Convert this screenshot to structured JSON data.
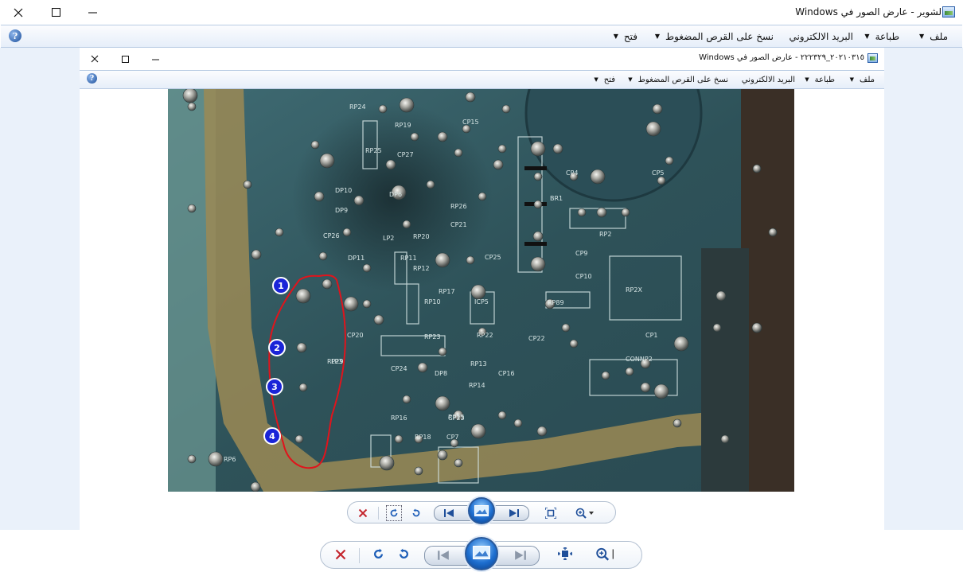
{
  "outer_window": {
    "title": "لشوير - عارض الصور في Windows",
    "menu": {
      "file": "ملف",
      "print": "طباعة",
      "email": "البريد الالكتروني",
      "burn": "نسخ على القرص المضغوط",
      "open": "فتح"
    }
  },
  "inner_window": {
    "title": "٢٠٢١٠٣١٥_٢٢٢٣٢٩ - عارض الصور في Windows",
    "menu": {
      "file": "ملف",
      "print": "طباعة",
      "email": "البريد الالكتروني",
      "burn": "نسخ على القرص المضغوط",
      "open": "فتح"
    }
  },
  "photo": {
    "markers": [
      "1",
      "2",
      "3",
      "4"
    ],
    "pcb_labels": [
      "CP15",
      "CP27",
      "RP25",
      "RP24",
      "RP19",
      "DP10",
      "DP9",
      "DP6",
      "RP26",
      "CP21",
      "RP20",
      "CP26",
      "LP2",
      "RP11",
      "RP12",
      "CP25",
      "CP4",
      "CP5",
      "BR1",
      "RP2",
      "CP9",
      "CP10",
      "RP89",
      "RP2X",
      "RP22",
      "RP13",
      "RP14",
      "RP10",
      "RP23",
      "CP20",
      "CP24",
      "CP22",
      "CP16",
      "DP8",
      "RP16",
      "CP23",
      "RP15",
      "CP7",
      "CP1",
      "CONNP2",
      "LP3",
      "DP11",
      "RP29",
      "RP18",
      "RP6",
      "ICP5",
      "RP17"
    ],
    "annotation_color": "#e0141c",
    "marker_color": "#1a24d8"
  },
  "toolbar_icons": [
    "delete-icon",
    "rotate-clockwise-icon",
    "rotate-counterclockwise-icon",
    "previous-icon",
    "slideshow-icon",
    "next-icon",
    "actual-size-icon",
    "zoom-icon"
  ]
}
